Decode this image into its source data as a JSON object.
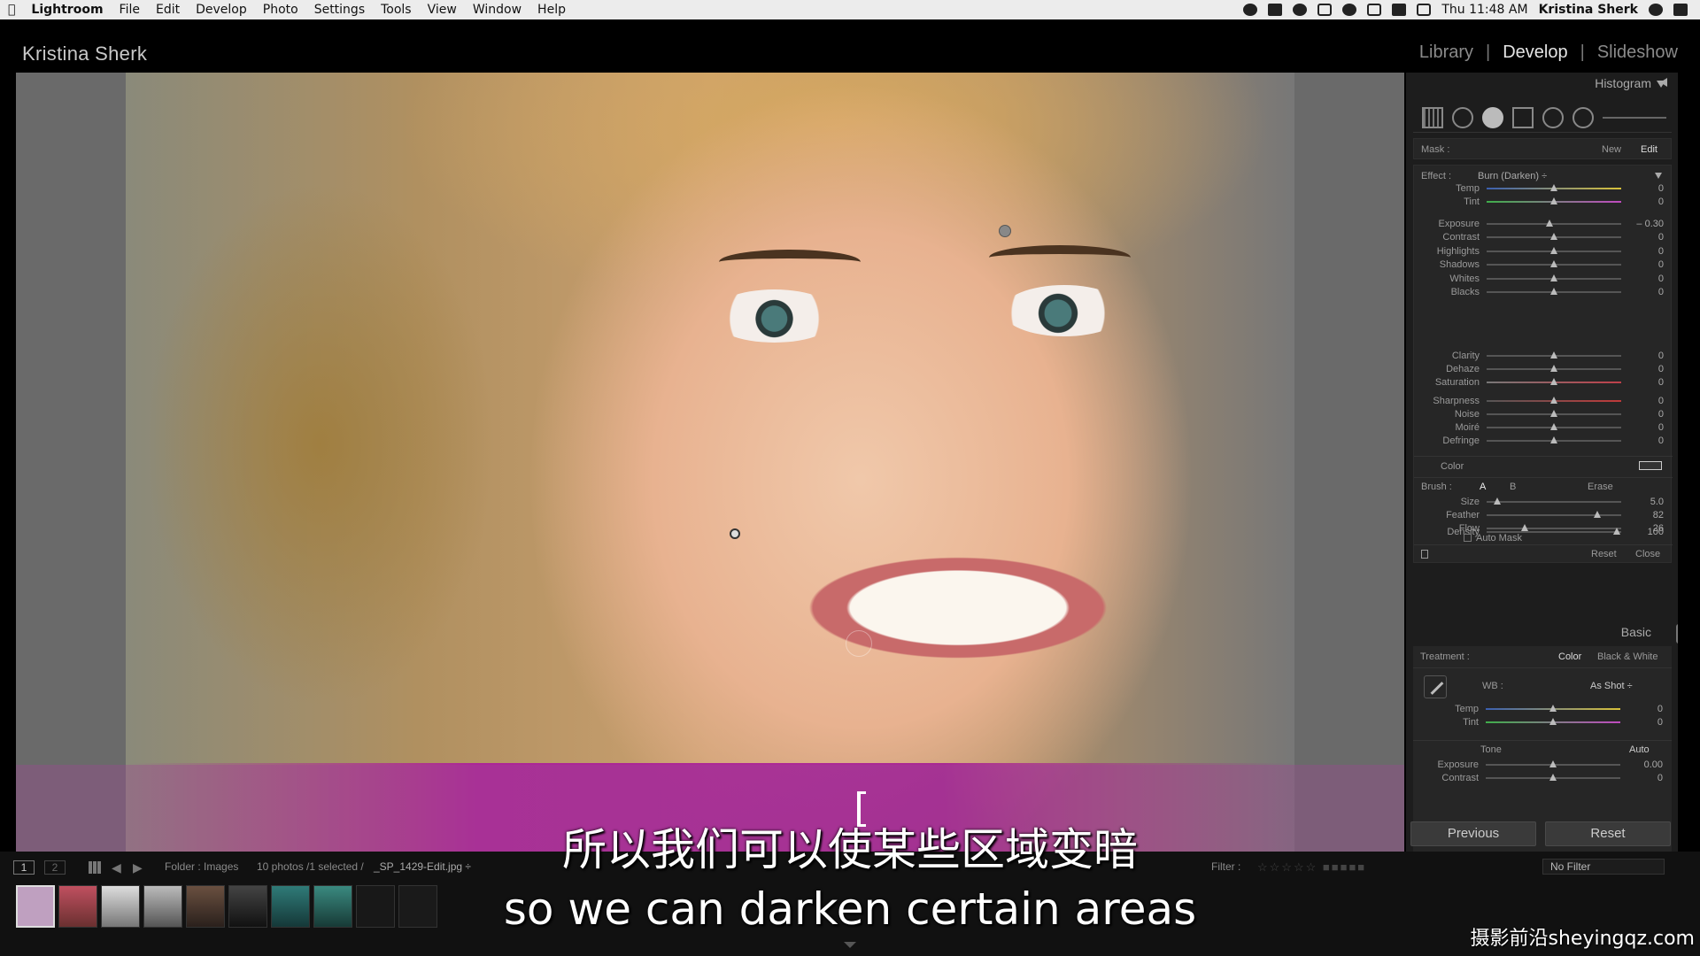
{
  "menubar": {
    "app": "Lightroom",
    "items": [
      "File",
      "Edit",
      "Develop",
      "Photo",
      "Settings",
      "Tools",
      "View",
      "Window",
      "Help"
    ],
    "clock": "Thu 11:48 AM",
    "user": "Kristina Sherk"
  },
  "header": {
    "identity": "Kristina Sherk",
    "modules": [
      "Library",
      "Develop",
      "Slideshow"
    ],
    "active_module": "Develop"
  },
  "panel": {
    "histogram_label": "Histogram",
    "mask": {
      "label": "Mask :",
      "new": "New",
      "edit": "Edit"
    },
    "effect": {
      "label": "Effect :",
      "value": "Burn (Darken) ÷"
    },
    "sliders_group1": [
      {
        "label": "Temp",
        "value": "0",
        "pos": 0.5
      },
      {
        "label": "Tint",
        "value": "0",
        "pos": 0.5
      }
    ],
    "sliders_group2": [
      {
        "label": "Exposure",
        "value": "– 0.30",
        "pos": 0.47
      },
      {
        "label": "Contrast",
        "value": "0",
        "pos": 0.5
      },
      {
        "label": "Highlights",
        "value": "0",
        "pos": 0.5
      },
      {
        "label": "Shadows",
        "value": "0",
        "pos": 0.5
      },
      {
        "label": "Whites",
        "value": "0",
        "pos": 0.5
      },
      {
        "label": "Blacks",
        "value": "0",
        "pos": 0.5
      }
    ],
    "sliders_group3": [
      {
        "label": "Clarity",
        "value": "0",
        "pos": 0.5
      },
      {
        "label": "Dehaze",
        "value": "0",
        "pos": 0.5
      },
      {
        "label": "Saturation",
        "value": "0",
        "pos": 0.5
      }
    ],
    "sliders_group4": [
      {
        "label": "Sharpness",
        "value": "0",
        "pos": 0.5
      },
      {
        "label": "Noise",
        "value": "0",
        "pos": 0.5
      },
      {
        "label": "Moiré",
        "value": "0",
        "pos": 0.5
      },
      {
        "label": "Defringe",
        "value": "0",
        "pos": 0.5
      }
    ],
    "color_label": "Color",
    "brush": {
      "label": "Brush :",
      "a": "A",
      "b": "B",
      "erase": "Erase"
    },
    "brush_sliders": [
      {
        "label": "Size",
        "value": "5.0",
        "pos": 0.08
      },
      {
        "label": "Feather",
        "value": "82",
        "pos": 0.82
      },
      {
        "label": "Flow",
        "value": "26",
        "pos": 0.28
      }
    ],
    "auto_mask": "Auto Mask",
    "density": {
      "label": "Density",
      "value": "100",
      "pos": 0.97
    },
    "reset": "Reset",
    "close": "Close",
    "basic": {
      "header": "Basic",
      "treatment_label": "Treatment :",
      "color": "Color",
      "bw": "Black & White",
      "wb_label": "WB :",
      "wb_value": "As Shot ÷",
      "wb_sliders": [
        {
          "label": "Temp",
          "value": "0",
          "pos": 0.5
        },
        {
          "label": "Tint",
          "value": "0",
          "pos": 0.5
        }
      ],
      "tone_label": "Tone",
      "auto": "Auto",
      "tone_sliders": [
        {
          "label": "Exposure",
          "value": "0.00",
          "pos": 0.5
        },
        {
          "label": "Contrast",
          "value": "0",
          "pos": 0.5
        }
      ]
    },
    "previous": "Previous",
    "reset_button": "Reset"
  },
  "filmstrip": {
    "page1": "1",
    "page2": "2",
    "folder": "Folder : Images",
    "count": "10 photos /1 selected /",
    "filename": "_SP_1429-Edit.jpg ÷",
    "filter_label": "Filter :",
    "filter_value": "No Filter",
    "thumb_count": 10
  },
  "subtitles": {
    "cn": "所以我们可以使某些区域变暗",
    "en": "so we can darken certain areas"
  },
  "watermark": "摄影前沿sheyingqz.com"
}
